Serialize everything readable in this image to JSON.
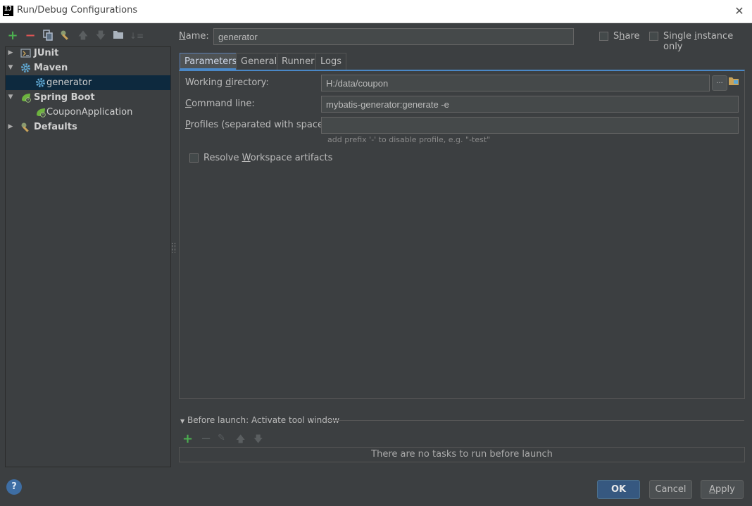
{
  "window": {
    "title": "Run/Debug Configurations",
    "app_logo": "IJ"
  },
  "toolbar": {
    "icons": [
      "add-icon",
      "remove-icon",
      "copy-icon",
      "wrench-icon",
      "move-up-icon",
      "move-down-icon",
      "folder-icon",
      "sort-icon"
    ],
    "colors": {
      "add": "#4caf50",
      "remove": "#e05555"
    }
  },
  "tree": {
    "items": [
      {
        "label": "JUnit",
        "level": 0,
        "expanded": false,
        "icon": "junit-icon"
      },
      {
        "label": "Maven",
        "level": 0,
        "expanded": true,
        "icon": "maven-gear-icon"
      },
      {
        "label": "generator",
        "level": 1,
        "selected": true,
        "icon": "maven-gear-icon"
      },
      {
        "label": "Spring Boot",
        "level": 0,
        "expanded": true,
        "icon": "spring-boot-icon"
      },
      {
        "label": "CouponApplication",
        "level": 1,
        "icon": "spring-boot-icon"
      },
      {
        "label": "Defaults",
        "level": 0,
        "expanded": false,
        "icon": "wrench-icon"
      }
    ]
  },
  "form": {
    "name_label": "Name:",
    "name_value": "generator",
    "share_label": "Share",
    "single_instance_label": "Single instance only",
    "tabs": [
      "Parameters",
      "General",
      "Runner",
      "Logs"
    ],
    "active_tab": "Parameters",
    "working_dir_label": "Working directory:",
    "working_dir_value": "H:/data/coupon",
    "browse_label": "...",
    "command_line_label": "Command line:",
    "command_line_value": "mybatis-generator:generate -e",
    "profiles_label": "Profiles (separated with space):",
    "profiles_value": "",
    "profiles_hint": "add prefix '-' to disable profile, e.g. \"-test\"",
    "resolve_workspace_label": "Resolve Workspace artifacts"
  },
  "before_launch": {
    "title": "Before launch: Activate tool window",
    "empty_text": "There are no tasks to run before launch"
  },
  "buttons": {
    "ok": "OK",
    "cancel": "Cancel",
    "apply": "Apply",
    "help": "?"
  }
}
